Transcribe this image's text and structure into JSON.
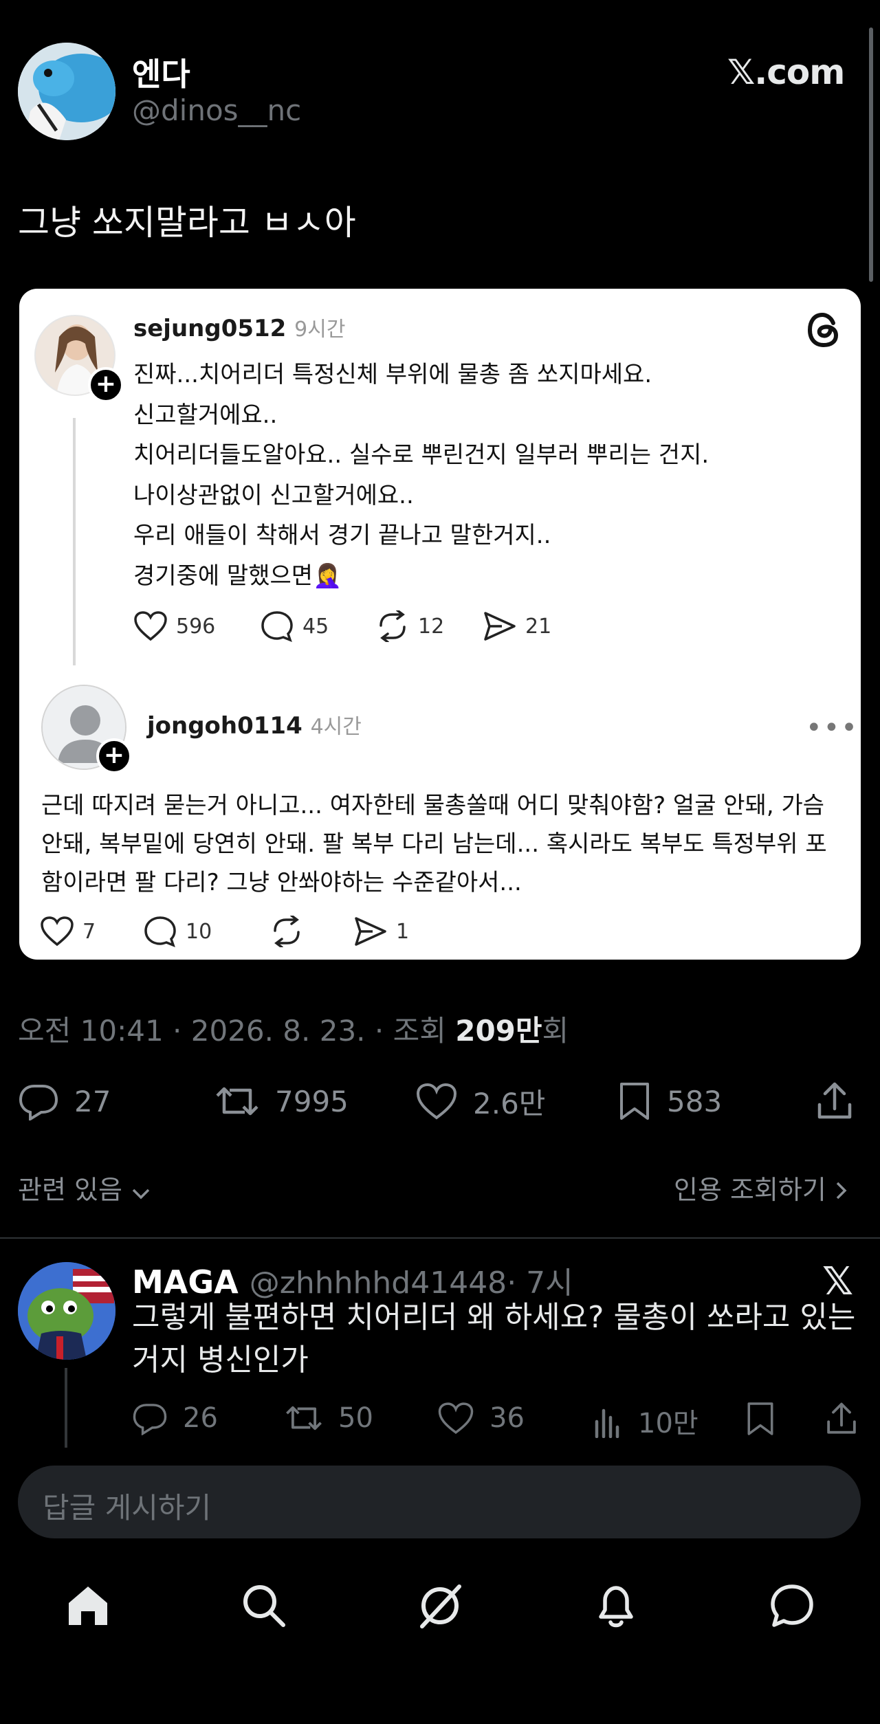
{
  "header": {
    "display_name": "엔다",
    "handle": "@dinos__nc",
    "brand": "𝕏.com"
  },
  "post": {
    "text": "그냥 쏘지말라고 ㅂㅅ아"
  },
  "embedded_threads": {
    "post1": {
      "user": "sejung0512",
      "time": "9시간",
      "lines": [
        "진짜...치어리더 특정신체 부위에 물총 좀 쏘지마세요.",
        "신고할거에요..",
        "치어리더들도알아요.. 실수로 뿌린건지 일부러 뿌리는 건지.",
        "나이상관없이 신고할거에요..",
        "우리 애들이 착해서 경기 끝나고 말한거지..",
        "경기중에 말했으면🤦‍♀️"
      ],
      "likes": "596",
      "comments": "45",
      "reposts": "12",
      "shares": "21"
    },
    "post2": {
      "user": "jongoh0114",
      "time": "4시간",
      "more": "•••",
      "body_lines": [
        "근데 따지려 묻는거 아니고... 여자한테 물총쏠때 어디 맞춰야함? 얼굴 안돼, 가슴",
        "안돼, 복부밑에 당연히 안돼. 팔 복부 다리 남는데... 혹시라도 복부도 특정부위 포",
        "함이라면 팔 다리? 그냥 안쏴야하는 수준같아서..."
      ],
      "likes": "7",
      "comments": "10",
      "shares": "1"
    }
  },
  "meta": {
    "time": "오전 10:41 · 2026. 8. 23. · 조회 ",
    "views_bold": "209만",
    "views_suffix": "회"
  },
  "stats": {
    "replies": "27",
    "reposts": "7995",
    "likes": "2.6만",
    "bookmarks": "583"
  },
  "related": {
    "left": "관련 있음",
    "right": "인용 조회하기"
  },
  "reply": {
    "name": "MAGA",
    "handle": "@zhhhhhd41448",
    "time": "· 7시",
    "text": "그렇게 불편하면 치어리더 왜 하세요? 물총이 쏘라고 있는 거지 병신인가",
    "replies": "26",
    "reposts": "50",
    "likes": "36",
    "views": "10만",
    "x_mark": "𝕏"
  },
  "composer": {
    "placeholder": "답글 게시하기"
  },
  "tabs": [
    "home",
    "search",
    "grok",
    "notifications",
    "messages"
  ]
}
